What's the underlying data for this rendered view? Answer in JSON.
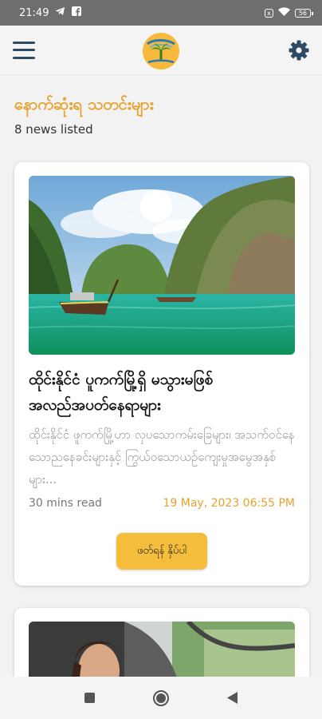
{
  "status_bar": {
    "time": "21:49",
    "icons": [
      "telegram-icon",
      "facebook-icon",
      "sim-off-icon",
      "wifi-icon",
      "battery-icon"
    ],
    "sim_label": "x",
    "battery_level": "56"
  },
  "app_bar": {
    "menu_icon": "hamburger-menu-icon",
    "logo_icon": "tropical-island-logo",
    "settings_icon": "gear-icon"
  },
  "page": {
    "title": "နောက်ဆုံးရ သတင်းများ",
    "count_label": "8 news listed"
  },
  "articles": [
    {
      "image": "tropical-lagoon-with-boats-and-limestone-cliffs",
      "title": "ထိုင်းနိုင်ငံ ပူကက်မြို့ရှိ မသွားမဖြစ် အလည်အပတ်နေရာများ",
      "excerpt": "ထိုင်းနိုင်ငံ ဖူကက်မြို့ဟာ လှပသောကမ်းခြေများ၊ အသက်ဝင်နေသောညနေခင်းများနှင့် ကြွယ်ဝသောယဉ်ကျေးမှုအမွေအနှစ်များ...",
      "read_time": "30 mins read",
      "date": "19 May, 2023 06:55 PM",
      "button_label": "ဖတ်ရန် နှိပ်ပါ"
    },
    {
      "image": "woman-driving-car"
    }
  ],
  "nav_bar": {
    "buttons": [
      "recent-apps-icon",
      "home-icon",
      "back-icon"
    ]
  },
  "colors": {
    "accent": "#e8a12e",
    "button": "#f4bd3c",
    "icon": "#2e4a62",
    "status_bar": "#6e6e6e"
  }
}
